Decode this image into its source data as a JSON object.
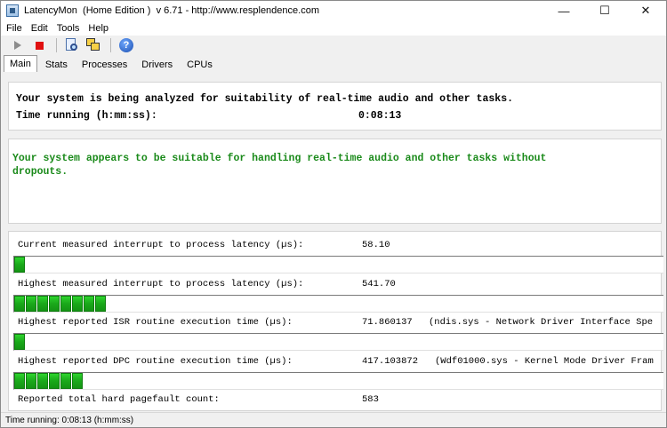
{
  "window": {
    "title": "LatencyMon  (Home Edition )  v 6.71 - http://www.resplendence.com",
    "minimize": "—",
    "maximize": "☐",
    "close": "✕"
  },
  "menu": {
    "file": "File",
    "edit": "Edit",
    "tools": "Tools",
    "help": "Help"
  },
  "tabs": [
    "Main",
    "Stats",
    "Processes",
    "Drivers",
    "CPUs"
  ],
  "analysis": {
    "line1": "Your system is being analyzed for suitability of real-time audio and other tasks.",
    "time_label": "Time running (h:mm:ss):",
    "time_value": "0:08:13"
  },
  "verdict": {
    "text": "Your system appears to be suitable for handling real-time audio and other tasks without dropouts.",
    "color": "#1a8a1a"
  },
  "metrics": [
    {
      "label": "Current measured interrupt to process latency (µs):",
      "value": "58.10",
      "extra": "",
      "meter_fraction": 0.02
    },
    {
      "label": "Highest measured interrupt to process latency (µs):",
      "value": "541.70",
      "extra": "",
      "meter_fraction": 0.145
    },
    {
      "label": "Highest reported ISR routine execution time (µs):",
      "value": "71.860137",
      "extra": "(ndis.sys - Network Driver Interface Spe",
      "meter_fraction": 0.02
    },
    {
      "label": "Highest reported DPC routine execution time (µs):",
      "value": "417.103872",
      "extra": "(Wdf01000.sys - Kernel Mode Driver Fram",
      "meter_fraction": 0.11
    },
    {
      "label": "Reported total hard pagefault count:",
      "value": "583",
      "extra": ""
    }
  ],
  "status": {
    "text": "Time running: 0:08:13  (h:mm:ss)"
  },
  "colors": {
    "meter_green": "#1aa81a",
    "stop_red": "#e01010"
  },
  "icons": [
    "play-icon",
    "stop-icon",
    "search-icon",
    "windows-icon",
    "help-icon"
  ]
}
